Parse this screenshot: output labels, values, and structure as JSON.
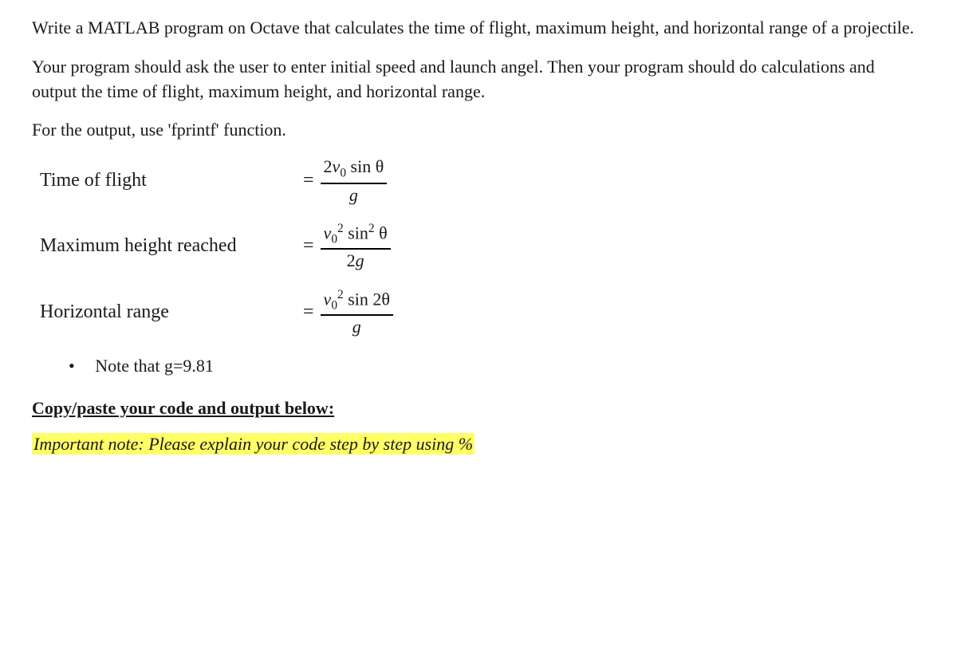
{
  "para1": "Write a MATLAB program on Octave that calculates the time of flight, maximum height, and horizontal range of a projectile.",
  "para2": "Your program should ask the user to enter initial speed and launch angel. Then your program should do calculations and output the time of flight, maximum height, and horizontal range.",
  "para3": "For the output, use 'fprintf' function.",
  "formulas": {
    "row1": {
      "label": "Time of flight"
    },
    "row2": {
      "label": "Maximum height reached"
    },
    "row3": {
      "label": "Horizontal range"
    }
  },
  "note": "Note that g=9.81",
  "copyPaste": "Copy/paste your code and output below:",
  "important": "Important note: Please explain your code step by step using %"
}
